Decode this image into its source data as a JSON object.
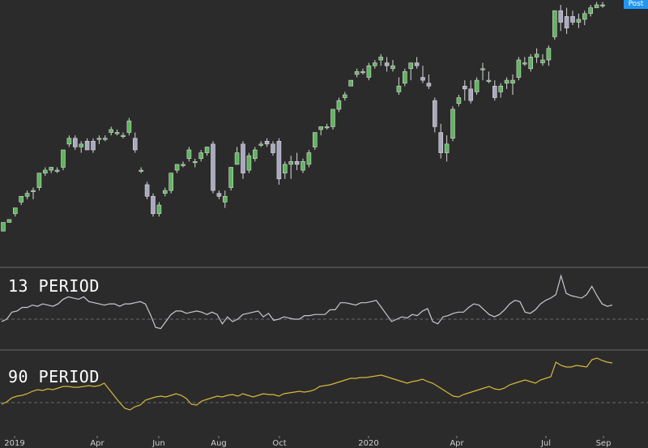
{
  "badge": "Post",
  "panels": {
    "p13": "13 PERIOD",
    "p90": "90 PERIOD"
  },
  "colors": {
    "background": "#2c2b2b",
    "up_candle": "#5cb85c",
    "down_candle": "#a9a9c2",
    "wick": "#d8d8d8",
    "line13": "#c8c8d4",
    "line90": "#d4b93c",
    "separator": "#6a6a6a",
    "zero_line": "#6a6a6a"
  },
  "chart_data": [
    {
      "type": "candlestick",
      "title": "",
      "xlabel": "",
      "ylabel": "",
      "x_ticks": [
        "2019",
        "Apr",
        "Jun",
        "Aug",
        "Oct",
        "2020",
        "Apr",
        "Jul",
        "Sep"
      ],
      "grid": false,
      "candles": [
        {
          "o": 28,
          "h": 31,
          "l": 28,
          "c": 31
        },
        {
          "o": 31,
          "h": 32,
          "l": 31,
          "c": 32
        },
        {
          "o": 34,
          "h": 36,
          "l": 33,
          "c": 36
        },
        {
          "o": 38,
          "h": 40,
          "l": 37,
          "c": 40
        },
        {
          "o": 40,
          "h": 42,
          "l": 39,
          "c": 41
        },
        {
          "o": 42,
          "h": 43,
          "l": 39,
          "c": 42
        },
        {
          "o": 43,
          "h": 48,
          "l": 42,
          "c": 48
        },
        {
          "o": 48,
          "h": 50,
          "l": 47,
          "c": 49
        },
        {
          "o": 49,
          "h": 50,
          "l": 48,
          "c": 50
        },
        {
          "o": 49,
          "h": 50,
          "l": 48,
          "c": 49
        },
        {
          "o": 50,
          "h": 56,
          "l": 49,
          "c": 56
        },
        {
          "o": 58,
          "h": 61,
          "l": 57,
          "c": 60
        },
        {
          "o": 60,
          "h": 61,
          "l": 56,
          "c": 57
        },
        {
          "o": 57,
          "h": 59,
          "l": 55,
          "c": 58
        },
        {
          "o": 59,
          "h": 60,
          "l": 56,
          "c": 56
        },
        {
          "o": 59,
          "h": 60,
          "l": 55,
          "c": 56
        },
        {
          "o": 60,
          "h": 61,
          "l": 58,
          "c": 60
        },
        {
          "o": 60,
          "h": 61,
          "l": 59,
          "c": 60
        },
        {
          "o": 62,
          "h": 64,
          "l": 61,
          "c": 63
        },
        {
          "o": 62,
          "h": 63,
          "l": 61,
          "c": 62
        },
        {
          "o": 61,
          "h": 62,
          "l": 60,
          "c": 61
        },
        {
          "o": 62,
          "h": 67,
          "l": 61,
          "c": 66
        },
        {
          "o": 60,
          "h": 62,
          "l": 55,
          "c": 56
        },
        {
          "o": 49,
          "h": 50,
          "l": 48,
          "c": 49
        },
        {
          "o": 44,
          "h": 45,
          "l": 39,
          "c": 40
        },
        {
          "o": 40,
          "h": 41,
          "l": 33,
          "c": 34
        },
        {
          "o": 34,
          "h": 38,
          "l": 33,
          "c": 37
        },
        {
          "o": 41,
          "h": 43,
          "l": 40,
          "c": 42
        },
        {
          "o": 42,
          "h": 48,
          "l": 41,
          "c": 48
        },
        {
          "o": 49,
          "h": 51,
          "l": 48,
          "c": 51
        },
        {
          "o": 51,
          "h": 52,
          "l": 50,
          "c": 51
        },
        {
          "o": 53,
          "h": 57,
          "l": 52,
          "c": 56
        },
        {
          "o": 52,
          "h": 53,
          "l": 50,
          "c": 52
        },
        {
          "o": 53,
          "h": 56,
          "l": 52,
          "c": 55
        },
        {
          "o": 55,
          "h": 57,
          "l": 54,
          "c": 57
        },
        {
          "o": 58,
          "h": 59,
          "l": 41,
          "c": 42
        },
        {
          "o": 41,
          "h": 42,
          "l": 39,
          "c": 40
        },
        {
          "o": 38,
          "h": 42,
          "l": 36,
          "c": 40
        },
        {
          "o": 43,
          "h": 50,
          "l": 42,
          "c": 50
        },
        {
          "o": 51,
          "h": 57,
          "l": 51,
          "c": 55
        },
        {
          "o": 58,
          "h": 59,
          "l": 46,
          "c": 48
        },
        {
          "o": 49,
          "h": 55,
          "l": 48,
          "c": 54
        },
        {
          "o": 53,
          "h": 57,
          "l": 52,
          "c": 56
        },
        {
          "o": 58,
          "h": 59,
          "l": 57,
          "c": 58
        },
        {
          "o": 59,
          "h": 60,
          "l": 57,
          "c": 58
        },
        {
          "o": 58,
          "h": 59,
          "l": 54,
          "c": 55
        },
        {
          "o": 59,
          "h": 60,
          "l": 44,
          "c": 46
        },
        {
          "o": 48,
          "h": 52,
          "l": 46,
          "c": 51
        },
        {
          "o": 51,
          "h": 54,
          "l": 46,
          "c": 52
        },
        {
          "o": 52,
          "h": 55,
          "l": 49,
          "c": 51
        },
        {
          "o": 49,
          "h": 53,
          "l": 48,
          "c": 52
        },
        {
          "o": 51,
          "h": 56,
          "l": 50,
          "c": 55
        },
        {
          "o": 57,
          "h": 62,
          "l": 56,
          "c": 62
        },
        {
          "o": 63,
          "h": 64,
          "l": 61,
          "c": 64
        },
        {
          "o": 64,
          "h": 65,
          "l": 63,
          "c": 64
        },
        {
          "o": 64,
          "h": 70,
          "l": 63,
          "c": 70
        },
        {
          "o": 70,
          "h": 74,
          "l": 69,
          "c": 73
        },
        {
          "o": 74,
          "h": 76,
          "l": 73,
          "c": 75
        },
        {
          "o": 78,
          "h": 80,
          "l": 78,
          "c": 80
        },
        {
          "o": 82,
          "h": 84,
          "l": 81,
          "c": 83
        },
        {
          "o": 83,
          "h": 84,
          "l": 82,
          "c": 83
        },
        {
          "o": 81,
          "h": 86,
          "l": 80,
          "c": 85
        },
        {
          "o": 85,
          "h": 87,
          "l": 84,
          "c": 86
        },
        {
          "o": 87,
          "h": 89,
          "l": 85,
          "c": 88
        },
        {
          "o": 86,
          "h": 88,
          "l": 83,
          "c": 85
        },
        {
          "o": 84,
          "h": 87,
          "l": 83,
          "c": 85
        },
        {
          "o": 76,
          "h": 81,
          "l": 75,
          "c": 78
        },
        {
          "o": 79,
          "h": 84,
          "l": 78,
          "c": 83
        },
        {
          "o": 84,
          "h": 86,
          "l": 80,
          "c": 86
        },
        {
          "o": 86,
          "h": 88,
          "l": 84,
          "c": 85
        },
        {
          "o": 81,
          "h": 85,
          "l": 79,
          "c": 80
        },
        {
          "o": 79,
          "h": 82,
          "l": 77,
          "c": 78
        },
        {
          "o": 73,
          "h": 74,
          "l": 62,
          "c": 64
        },
        {
          "o": 62,
          "h": 65,
          "l": 53,
          "c": 55
        },
        {
          "o": 55,
          "h": 61,
          "l": 52,
          "c": 58
        },
        {
          "o": 60,
          "h": 71,
          "l": 59,
          "c": 70
        },
        {
          "o": 72,
          "h": 75,
          "l": 71,
          "c": 74
        },
        {
          "o": 78,
          "h": 80,
          "l": 73,
          "c": 77
        },
        {
          "o": 77,
          "h": 80,
          "l": 72,
          "c": 73
        },
        {
          "o": 76,
          "h": 81,
          "l": 75,
          "c": 80
        },
        {
          "o": 84,
          "h": 86,
          "l": 80,
          "c": 84
        },
        {
          "o": 80,
          "h": 83,
          "l": 79,
          "c": 80
        },
        {
          "o": 78,
          "h": 80,
          "l": 73,
          "c": 74
        },
        {
          "o": 76,
          "h": 79,
          "l": 74,
          "c": 78
        },
        {
          "o": 79,
          "h": 81,
          "l": 77,
          "c": 80
        },
        {
          "o": 79,
          "h": 82,
          "l": 75,
          "c": 80
        },
        {
          "o": 81,
          "h": 88,
          "l": 80,
          "c": 87
        },
        {
          "o": 86,
          "h": 88,
          "l": 85,
          "c": 86
        },
        {
          "o": 84,
          "h": 89,
          "l": 83,
          "c": 88
        },
        {
          "o": 88,
          "h": 91,
          "l": 86,
          "c": 89
        },
        {
          "o": 86,
          "h": 89,
          "l": 85,
          "c": 87
        },
        {
          "o": 87,
          "h": 92,
          "l": 85,
          "c": 91
        },
        {
          "o": 95,
          "h": 104,
          "l": 94,
          "c": 104
        },
        {
          "o": 104,
          "h": 106,
          "l": 97,
          "c": 100
        },
        {
          "o": 102,
          "h": 105,
          "l": 96,
          "c": 98
        },
        {
          "o": 102,
          "h": 104,
          "l": 99,
          "c": 100
        },
        {
          "o": 100,
          "h": 103,
          "l": 98,
          "c": 101
        },
        {
          "o": 101,
          "h": 104,
          "l": 99,
          "c": 103
        },
        {
          "o": 103,
          "h": 106,
          "l": 102,
          "c": 105
        },
        {
          "o": 105,
          "h": 107,
          "l": 105,
          "c": 106
        },
        {
          "o": 106,
          "h": 107,
          "l": 105,
          "c": 106
        }
      ]
    },
    {
      "type": "line",
      "series": [
        {
          "name": "13 PERIOD",
          "values": [
            -2,
            0,
            6,
            7,
            10,
            10,
            12,
            11,
            13,
            12,
            11,
            13,
            17,
            19,
            18,
            17,
            19,
            15,
            14,
            13,
            12,
            13,
            13,
            11,
            13,
            13,
            14,
            15,
            13,
            4,
            -7,
            -8,
            -2,
            4,
            7,
            7,
            5,
            6,
            7,
            6,
            4,
            6,
            4,
            -4,
            2,
            -2,
            0,
            4,
            5,
            6,
            7,
            2,
            5,
            -1,
            0,
            2,
            1,
            0,
            0,
            3,
            3,
            4,
            4,
            4,
            8,
            8,
            14,
            14,
            13,
            12,
            14,
            14,
            15,
            16,
            10,
            4,
            -2,
            0,
            2,
            1,
            4,
            3,
            7,
            9,
            -2,
            -4,
            2,
            3,
            5,
            6,
            6,
            10,
            13,
            12,
            8,
            4,
            2,
            4,
            8,
            13,
            16,
            15,
            6,
            5,
            8,
            13,
            16,
            18,
            21,
            37,
            22,
            20,
            19,
            18,
            21,
            28,
            20,
            13,
            11,
            12
          ]
        }
      ],
      "zero_line": true
    },
    {
      "type": "line",
      "series": [
        {
          "name": "90 PERIOD",
          "values": [
            -2,
            1,
            6,
            8,
            9,
            11,
            14,
            16,
            15,
            17,
            16,
            18,
            20,
            20,
            19,
            19,
            20,
            21,
            20,
            21,
            24,
            16,
            8,
            0,
            -7,
            -9,
            -5,
            -3,
            3,
            5,
            7,
            8,
            7,
            9,
            11,
            9,
            5,
            -2,
            -3,
            2,
            4,
            6,
            8,
            7,
            9,
            10,
            8,
            11,
            9,
            7,
            9,
            11,
            10,
            10,
            8,
            11,
            12,
            13,
            14,
            13,
            14,
            16,
            20,
            21,
            22,
            24,
            26,
            28,
            30,
            30,
            31,
            31,
            32,
            33,
            34,
            32,
            30,
            28,
            26,
            24,
            26,
            27,
            29,
            26,
            24,
            20,
            16,
            12,
            8,
            7,
            10,
            12,
            14,
            16,
            18,
            20,
            17,
            16,
            18,
            22,
            24,
            26,
            28,
            26,
            24,
            28,
            30,
            32,
            50,
            46,
            44,
            44,
            46,
            45,
            44,
            53,
            55,
            52,
            50,
            49
          ]
        }
      ],
      "zero_line": true
    }
  ]
}
